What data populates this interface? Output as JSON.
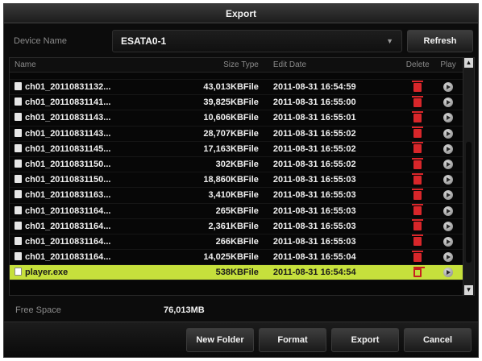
{
  "window": {
    "title": "Export"
  },
  "device": {
    "label": "Device Name",
    "selected": "ESATA0-1",
    "refresh_label": "Refresh"
  },
  "table": {
    "headers": {
      "name": "Name",
      "size_type": "Size Type",
      "edit_date": "Edit Date",
      "delete": "Delete",
      "play": "Play"
    },
    "rows": [
      {
        "name": "ch01_20110831132...",
        "size": "43,013KB",
        "type": "File",
        "date": "2011-08-31 16:54:59"
      },
      {
        "name": "ch01_20110831141...",
        "size": "39,825KB",
        "type": "File",
        "date": "2011-08-31 16:55:00"
      },
      {
        "name": "ch01_20110831143...",
        "size": "10,606KB",
        "type": "File",
        "date": "2011-08-31 16:55:01"
      },
      {
        "name": "ch01_20110831143...",
        "size": "28,707KB",
        "type": "File",
        "date": "2011-08-31 16:55:02"
      },
      {
        "name": "ch01_20110831145...",
        "size": "17,163KB",
        "type": "File",
        "date": "2011-08-31 16:55:02"
      },
      {
        "name": "ch01_20110831150...",
        "size": "302KB",
        "type": "File",
        "date": "2011-08-31 16:55:02"
      },
      {
        "name": "ch01_20110831150...",
        "size": "18,860KB",
        "type": "File",
        "date": "2011-08-31 16:55:03"
      },
      {
        "name": "ch01_20110831163...",
        "size": "3,410KB",
        "type": "File",
        "date": "2011-08-31 16:55:03"
      },
      {
        "name": "ch01_20110831164...",
        "size": "265KB",
        "type": "File",
        "date": "2011-08-31 16:55:03"
      },
      {
        "name": "ch01_20110831164...",
        "size": "2,361KB",
        "type": "File",
        "date": "2011-08-31 16:55:03"
      },
      {
        "name": "ch01_20110831164...",
        "size": "266KB",
        "type": "File",
        "date": "2011-08-31 16:55:03"
      },
      {
        "name": "ch01_20110831164...",
        "size": "14,025KB",
        "type": "File",
        "date": "2011-08-31 16:55:04"
      },
      {
        "name": "player.exe",
        "size": "538KB",
        "type": "File",
        "date": "2011-08-31 16:54:54"
      }
    ]
  },
  "free_space": {
    "label": "Free Space",
    "value": "76,013MB"
  },
  "footer": {
    "new_folder": "New Folder",
    "format": "Format",
    "export": "Export",
    "cancel": "Cancel"
  },
  "colors": {
    "selected_row": "#c6e03c",
    "delete_icon": "#d8262a",
    "background": "#0c0c0c"
  }
}
